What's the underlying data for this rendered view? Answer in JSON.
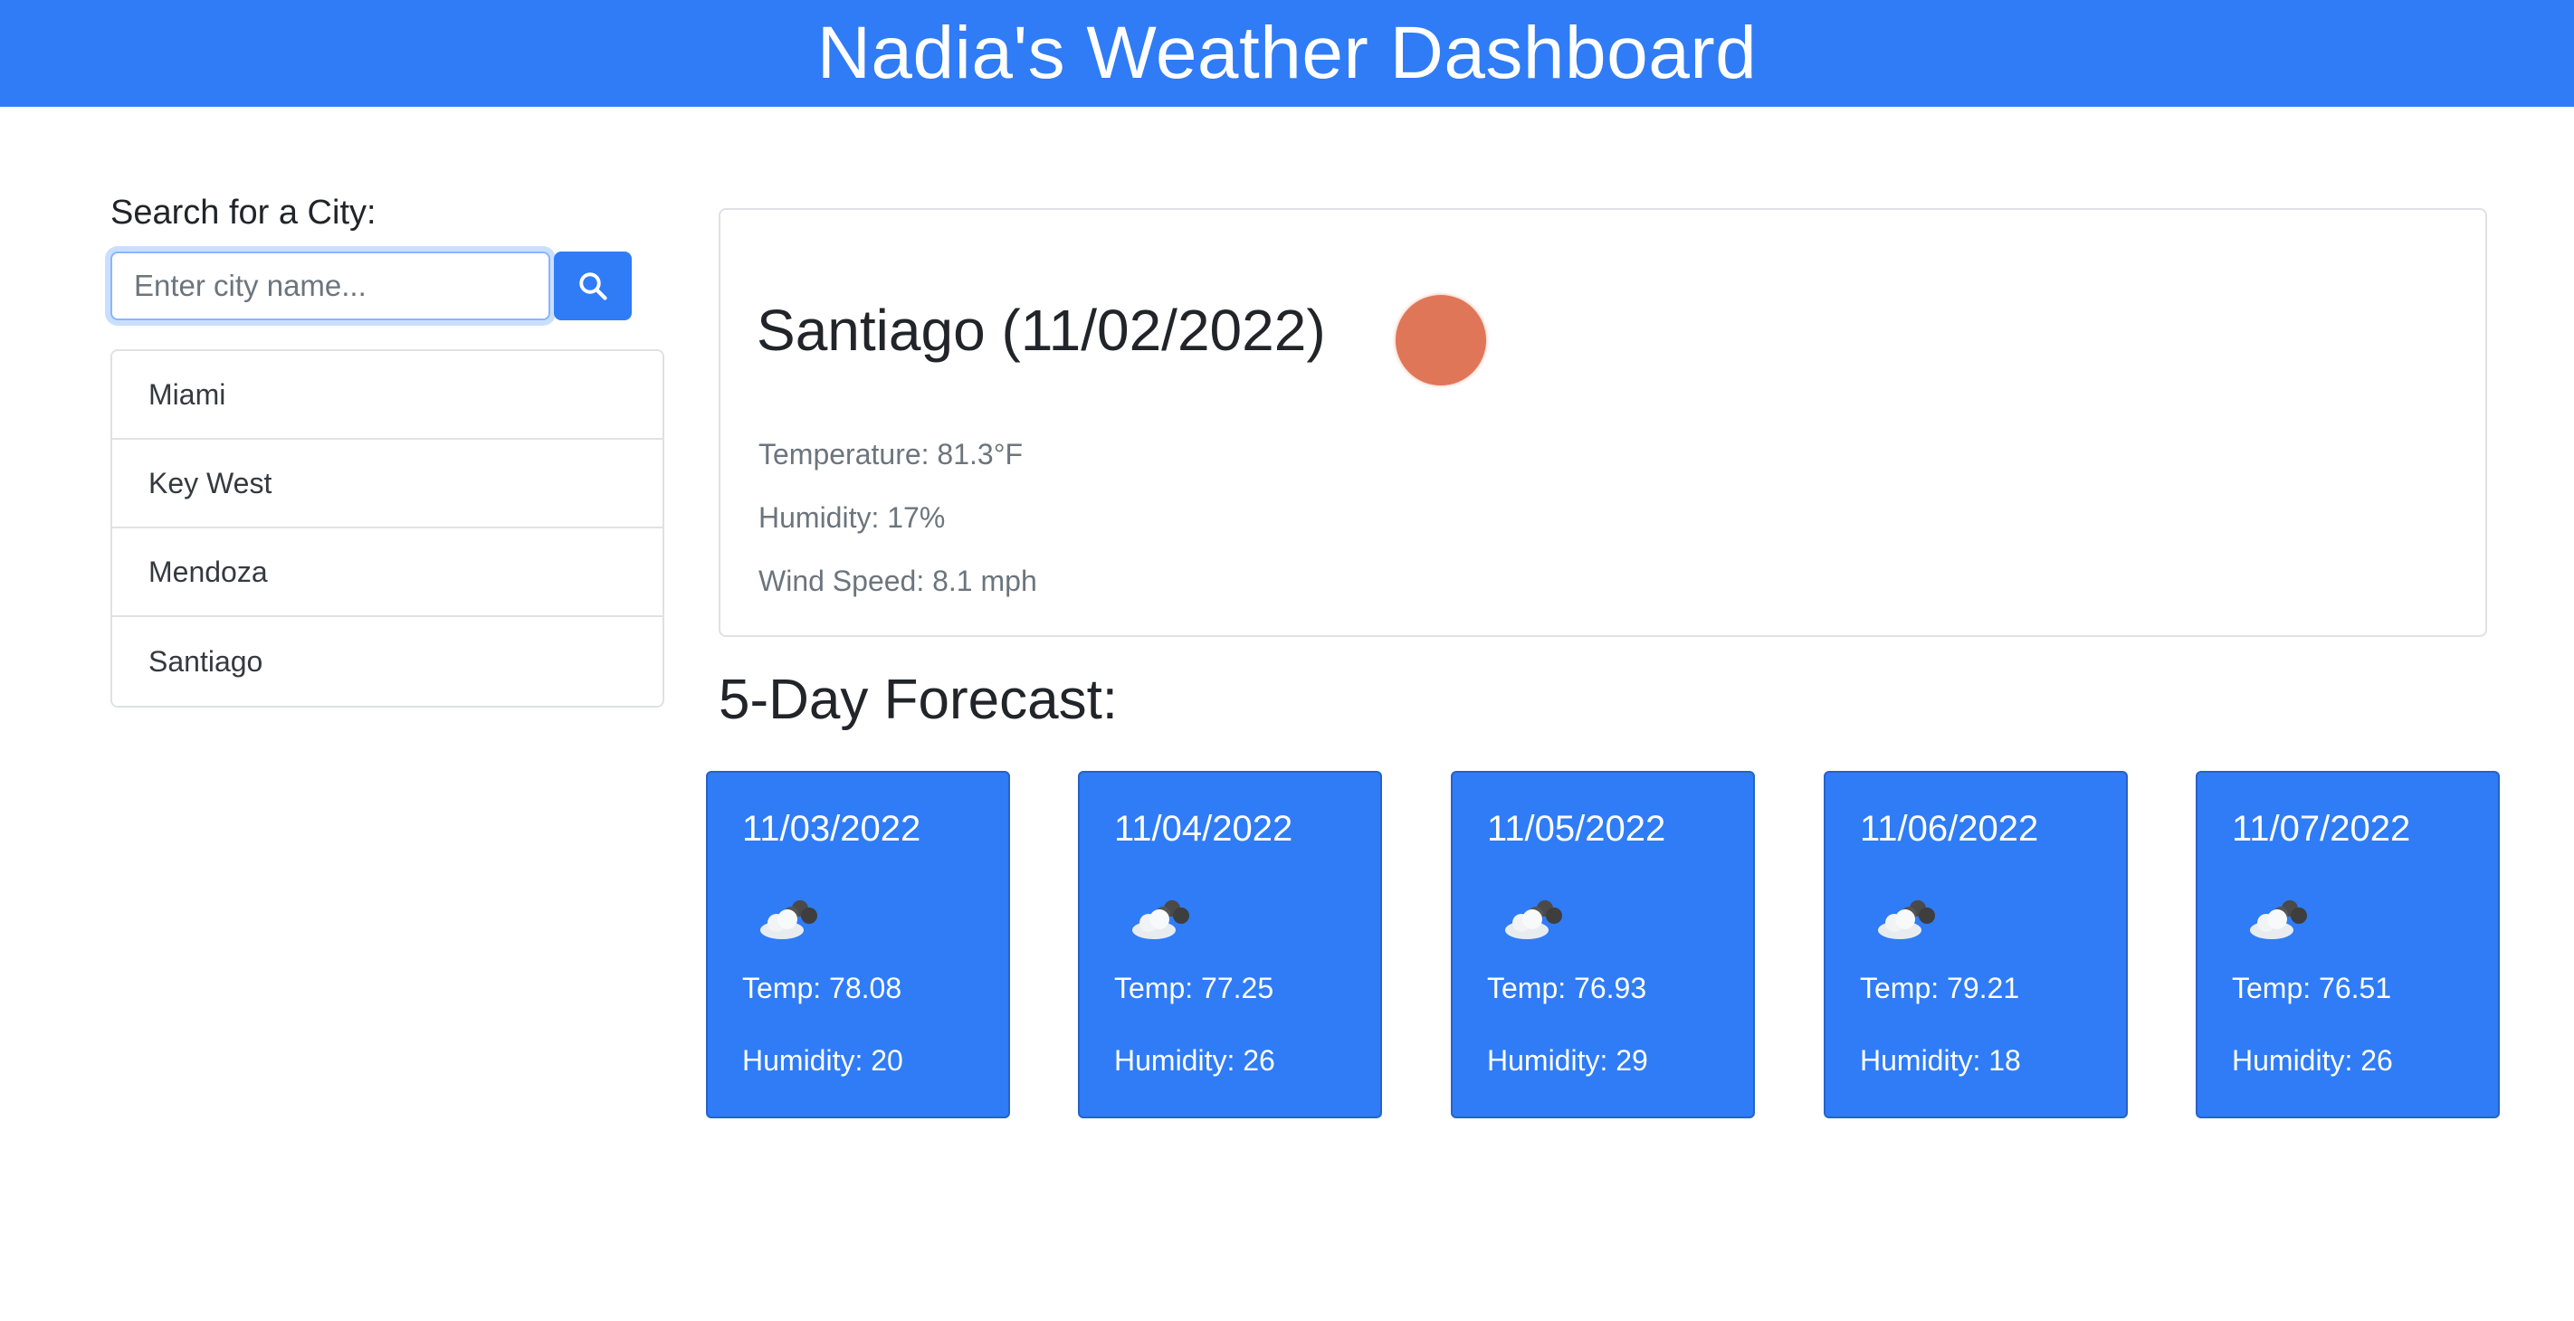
{
  "header": {
    "title": "Nadia's Weather Dashboard"
  },
  "search": {
    "label": "Search for a City:",
    "placeholder": "Enter city name...",
    "value": "",
    "button_icon": "search-icon"
  },
  "history": {
    "cities": [
      "Miami",
      "Key West",
      "Mendoza",
      "Santiago"
    ]
  },
  "current": {
    "title": "Santiago (11/02/2022)",
    "icon": "sun-icon",
    "temperature": "Temperature: 81.3°F",
    "humidity": "Humidity: 17%",
    "wind": "Wind Speed: 8.1 mph"
  },
  "forecast": {
    "heading": "5-Day Forecast:",
    "days": [
      {
        "date": "11/03/2022",
        "icon": "cloud-icon",
        "temp": "Temp: 78.08",
        "humidity": "Humidity: 20"
      },
      {
        "date": "11/04/2022",
        "icon": "cloud-icon",
        "temp": "Temp: 77.25",
        "humidity": "Humidity: 26"
      },
      {
        "date": "11/05/2022",
        "icon": "cloud-icon",
        "temp": "Temp: 76.93",
        "humidity": "Humidity: 29"
      },
      {
        "date": "11/06/2022",
        "icon": "cloud-icon",
        "temp": "Temp: 79.21",
        "humidity": "Humidity: 18"
      },
      {
        "date": "11/07/2022",
        "icon": "cloud-icon",
        "temp": "Temp: 76.51",
        "humidity": "Humidity: 26"
      }
    ]
  },
  "colors": {
    "primary": "#2f7cf6",
    "sun": "#e07658",
    "muted_text": "#6c757d",
    "border": "#dfe1e4"
  }
}
